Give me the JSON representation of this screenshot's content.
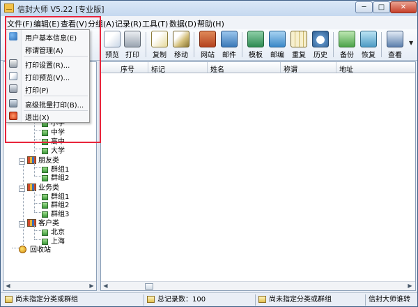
{
  "window": {
    "title": "信封大师 V5.22 [专业版]",
    "min_glyph": "─",
    "max_glyph": "□",
    "close_glyph": "✕"
  },
  "menu": [
    {
      "label": "文件(F)"
    },
    {
      "label": "编辑(E)"
    },
    {
      "label": "查看(V)"
    },
    {
      "label": "分组(A)"
    },
    {
      "label": "记录(R)"
    },
    {
      "label": "工具(T)"
    },
    {
      "label": "数据(D)"
    },
    {
      "label": "帮助(H)"
    }
  ],
  "file_menu": {
    "items": [
      {
        "label": "用户基本信息(E)",
        "icon": "users-icon"
      },
      {
        "label": "称谓管理(A)"
      },
      {
        "label": "打印设置(R)...",
        "icon": "print-settings-icon"
      },
      {
        "label": "打印预览(V)...",
        "icon": "print-preview-icon"
      },
      {
        "label": "打印(P)",
        "icon": "printer-icon"
      },
      {
        "label": "高级批量打印(B)...",
        "icon": "batch-print-icon"
      },
      {
        "label": "退出(X)",
        "icon": "exit-icon"
      }
    ]
  },
  "toolbar": [
    {
      "label": "预览",
      "icon": "preview-icon"
    },
    {
      "label": "打印",
      "icon": "printer-icon"
    },
    {
      "label": "复制",
      "icon": "copy-icon"
    },
    {
      "label": "移动",
      "icon": "move-icon"
    },
    {
      "label": "网站",
      "icon": "website-icon"
    },
    {
      "label": "邮件",
      "icon": "mail-icon"
    },
    {
      "label": "模板",
      "icon": "template-icon"
    },
    {
      "label": "邮编",
      "icon": "postcode-icon"
    },
    {
      "label": "重复",
      "icon": "duplicate-icon"
    },
    {
      "label": "历史",
      "icon": "history-icon"
    },
    {
      "label": "备份",
      "icon": "backup-icon"
    },
    {
      "label": "恢复",
      "icon": "restore-icon"
    },
    {
      "label": "查看",
      "icon": "view-icon"
    }
  ],
  "tree": {
    "school_children": [
      "小学",
      "中学",
      "高中",
      "大学"
    ],
    "groups": [
      {
        "label": "朋友类",
        "children": [
          "群组1",
          "群组2"
        ]
      },
      {
        "label": "业务类",
        "children": [
          "群组1",
          "群组2",
          "群组3"
        ]
      },
      {
        "label": "客户类",
        "children": [
          "北京",
          "上海"
        ]
      }
    ],
    "recycle": "回收站"
  },
  "list": {
    "columns": [
      "序号",
      "标记",
      "姓名",
      "称谓",
      "地址"
    ]
  },
  "status": {
    "left": "尚未指定分类或群组",
    "count": "总记录数：100",
    "right": "尚未指定分类或群组",
    "brand": "信封大师谁转"
  }
}
